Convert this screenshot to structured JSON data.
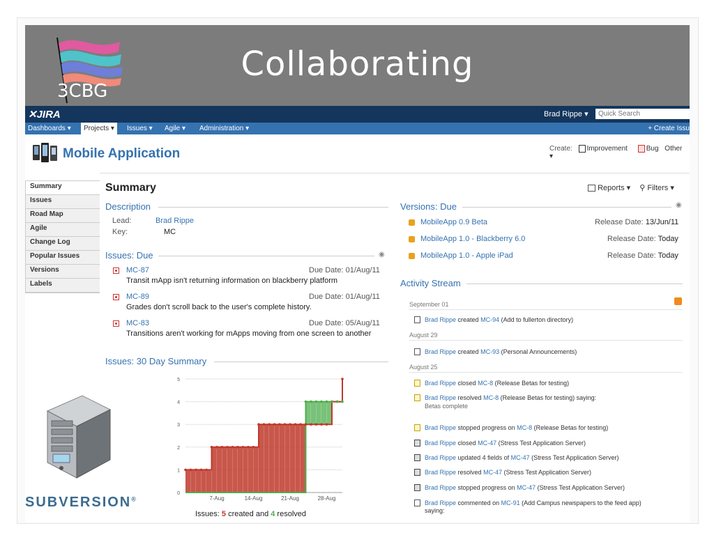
{
  "slide": {
    "title": "Collaborating",
    "logo_text": "3CBG",
    "subversion_text": "SUBVERSION",
    "subversion_mark": "®"
  },
  "jira": {
    "logo_text": "JIRA",
    "user_menu": "Brad Rippe ▾",
    "quick_search_placeholder": "Quick Search",
    "menu": [
      "Dashboards ▾",
      "Projects ▾",
      "Issues ▾",
      "Agile ▾",
      "Administration ▾"
    ],
    "create_issue": "+ Create Issu",
    "project_title": "Mobile Application",
    "create_bar": {
      "label": "Create:",
      "improvement": "Improvement",
      "bug": "Bug",
      "other": "Other ▾"
    },
    "sidebar": [
      "Summary",
      "Issues",
      "Road Map",
      "Agile",
      "Change Log",
      "Popular Issues",
      "Versions",
      "Labels"
    ],
    "summary_heading": "Summary",
    "reports": "Reports ▾",
    "filters": "Filters ▾",
    "description": {
      "heading": "Description",
      "lead_label": "Lead:",
      "lead_value": "Brad Rippe",
      "key_label": "Key:",
      "key_value": "MC"
    },
    "issues_due": {
      "heading": "Issues: Due",
      "items": [
        {
          "key": "MC-87",
          "due": "Due Date: 01/Aug/11",
          "summary": "Transit mApp isn't returning information on blackberry platform"
        },
        {
          "key": "MC-89",
          "due": "Due Date: 01/Aug/11",
          "summary": "Grades don't scroll back to the user's complete history."
        },
        {
          "key": "MC-83",
          "due": "Due Date: 05/Aug/11",
          "summary": "Transitions aren't working for mApps moving from one screen to another"
        }
      ]
    },
    "thirty_day": {
      "heading": "Issues: 30 Day Summary",
      "footer_prefix": "Issues: ",
      "footer_created": "5",
      "footer_mid": " created and ",
      "footer_resolved": "4",
      "footer_suffix": " resolved"
    },
    "versions_due": {
      "heading": "Versions: Due",
      "items": [
        {
          "name": "MobileApp 0.9 Beta",
          "label": "Release Date:",
          "date": "13/Jun/11"
        },
        {
          "name": "MobileApp 1.0 - Blackberry 6.0",
          "label": "Release Date:",
          "date": "Today"
        },
        {
          "name": "MobileApp 1.0 - Apple iPad",
          "label": "Release Date:",
          "date": "Today"
        }
      ]
    },
    "activity": {
      "heading": "Activity Stream",
      "dates": [
        "September 01",
        "August 29",
        "August 25"
      ],
      "entries": [
        {
          "user": "Brad Rippe",
          "action": "created",
          "key": "MC-94",
          "rest": "(Add to fullerton directory)",
          "icon": "improvement"
        },
        {
          "user": "Brad Rippe",
          "action": "created",
          "key": "MC-93",
          "rest": "(Personal Announcements)",
          "icon": "improvement"
        },
        {
          "user": "Brad Rippe",
          "action": "closed",
          "key": "MC-8",
          "rest": "(Release Betas for testing)",
          "icon": "doc"
        },
        {
          "user": "Brad Rippe",
          "action": "resolved",
          "key": "MC-8",
          "rest": "(Release Betas for testing) saying:",
          "extra": "Betas complete",
          "icon": "doc"
        },
        {
          "user": "Brad Rippe",
          "action": "stopped progress on",
          "key": "MC-8",
          "rest": "(Release Betas for testing)",
          "icon": "doc"
        },
        {
          "user": "Brad Rippe",
          "action": "closed",
          "key": "MC-47",
          "rest": "(Stress Test Application Server)",
          "icon": "server"
        },
        {
          "user": "Brad Rippe",
          "action": "updated 4 fields of",
          "key": "MC-47",
          "rest": "(Stress Test Application Server)",
          "icon": "server"
        },
        {
          "user": "Brad Rippe",
          "action": "resolved",
          "key": "MC-47",
          "rest": "(Stress Test Application Server)",
          "icon": "server"
        },
        {
          "user": "Brad Rippe",
          "action": "stopped progress on",
          "key": "MC-47",
          "rest": "(Stress Test Application Server)",
          "icon": "server"
        },
        {
          "user": "Brad Rippe",
          "action": "commented on",
          "key": "MC-91",
          "rest": "(Add Campus newspapers to the feed app)",
          "extra": "saying:",
          "icon": "improvement"
        }
      ]
    }
  },
  "chart_data": {
    "type": "area",
    "title": "",
    "xlabel": "",
    "ylabel": "",
    "ylim": [
      0,
      5
    ],
    "yticks": [
      "0",
      "1",
      "2",
      "3",
      "4",
      "5"
    ],
    "xticks": [
      {
        "label": "7-Aug",
        "day": 7
      },
      {
        "label": "14-Aug",
        "day": 14
      },
      {
        "label": "21-Aug",
        "day": 21
      },
      {
        "label": "28-Aug",
        "day": 28
      }
    ],
    "x": [
      1,
      2,
      3,
      4,
      5,
      6,
      7,
      8,
      9,
      10,
      11,
      12,
      13,
      14,
      15,
      16,
      17,
      18,
      19,
      20,
      21,
      22,
      23,
      24,
      25,
      26,
      27,
      28,
      29,
      30,
      31
    ],
    "series": [
      {
        "name": "created",
        "color": "#c0392b",
        "values": [
          1,
          1,
          1,
          1,
          1,
          2,
          2,
          2,
          2,
          2,
          2,
          2,
          2,
          2,
          3,
          3,
          3,
          3,
          3,
          3,
          3,
          3,
          3,
          3,
          3,
          3,
          3,
          3,
          4,
          4,
          5
        ]
      },
      {
        "name": "resolved",
        "color": "#4cae4c",
        "values": [
          0,
          0,
          0,
          0,
          0,
          0,
          0,
          0,
          0,
          0,
          0,
          0,
          0,
          0,
          0,
          0,
          0,
          0,
          0,
          0,
          0,
          0,
          0,
          4,
          4,
          4,
          4,
          4,
          4,
          4,
          4
        ]
      }
    ]
  },
  "colors": {
    "banner": "#7c7c7c",
    "jira_top": "#14365d",
    "jira_menu": "#3572b0",
    "link": "#3572b0"
  }
}
